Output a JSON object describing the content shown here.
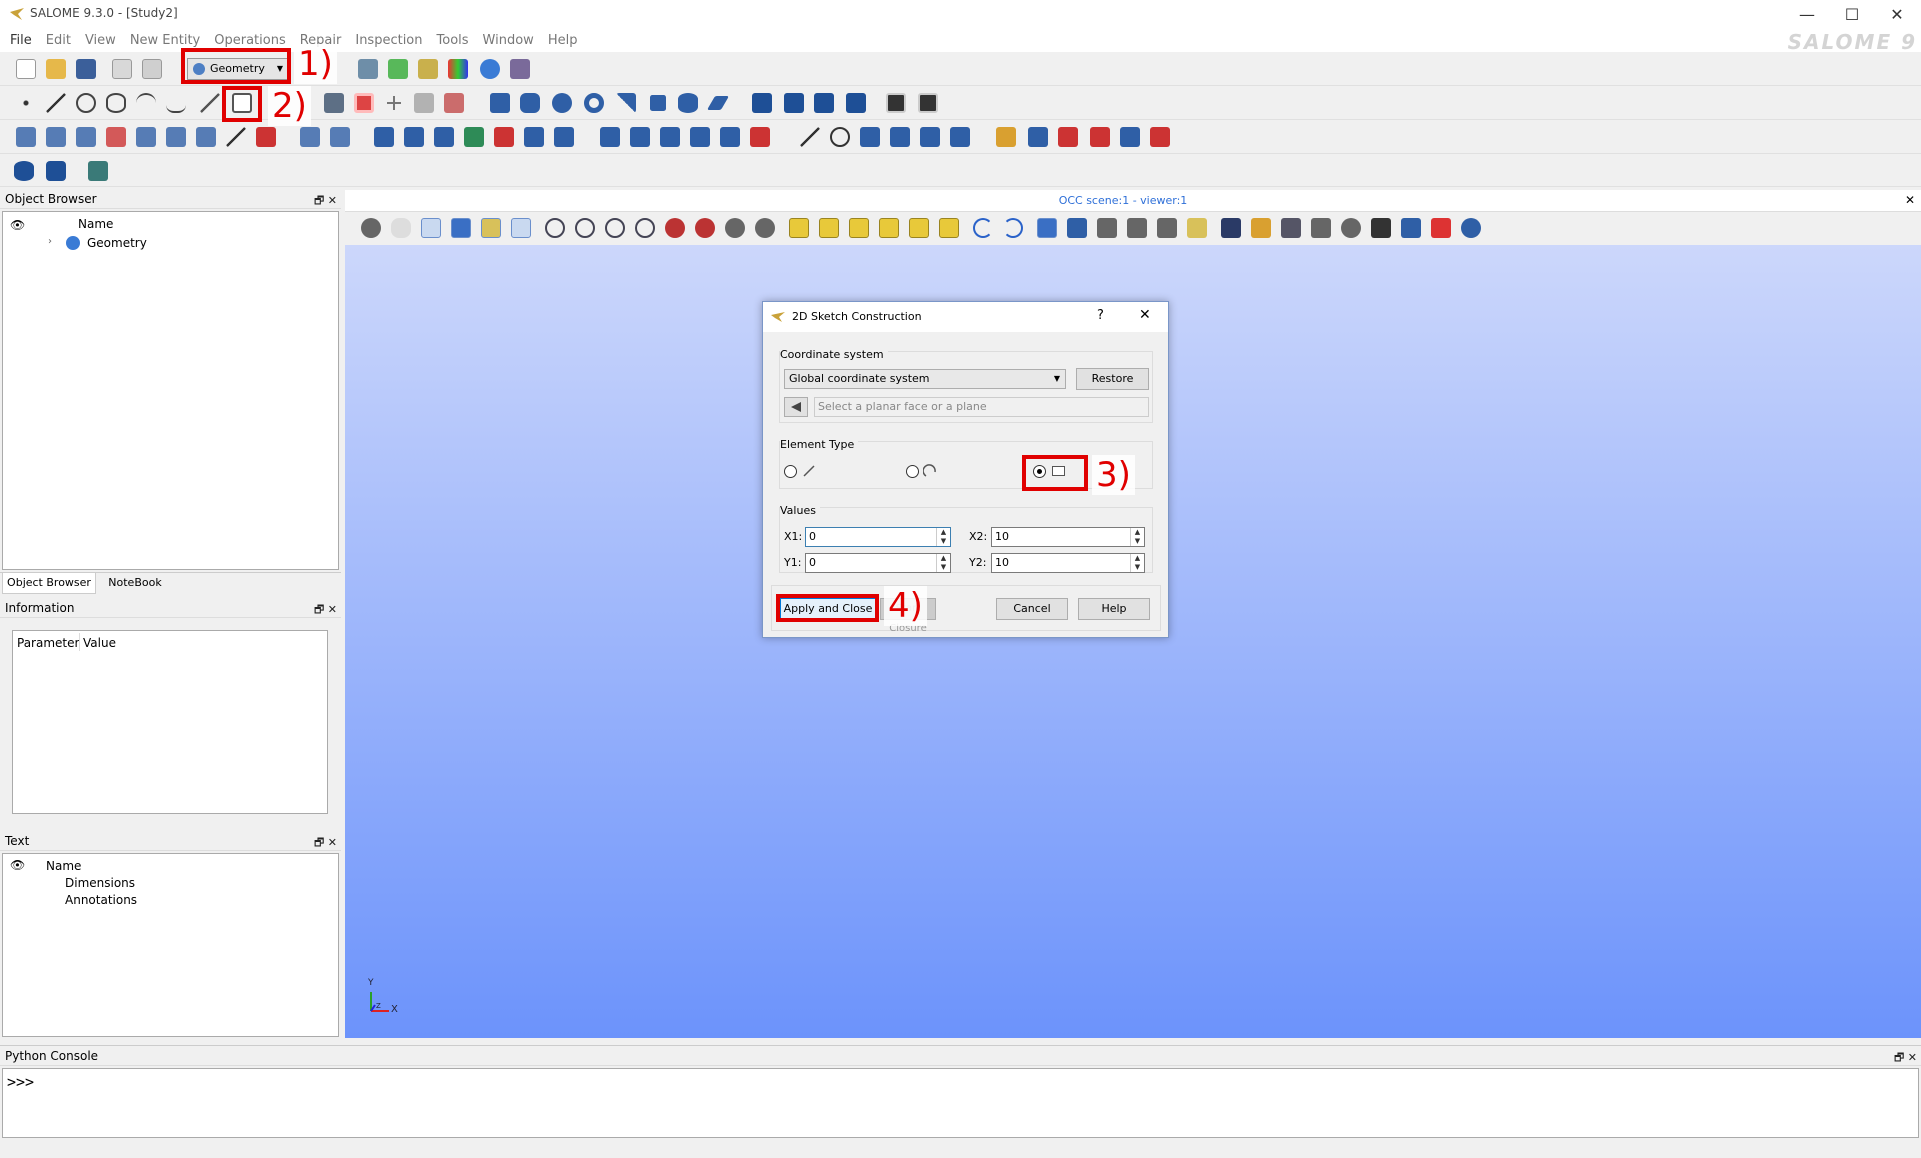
{
  "window": {
    "title": "SALOME 9.3.0 - [Study2]",
    "brand": "SALOME 9",
    "minimize": "—",
    "maximize": "☐",
    "close": "✕"
  },
  "menu": [
    "File",
    "Edit",
    "View",
    "New Entity",
    "Operations",
    "Repair",
    "Inspection",
    "Tools",
    "Window",
    "Help"
  ],
  "toolbar": {
    "module_selector": "Geometry"
  },
  "object_browser": {
    "title": "Object Browser",
    "column_name": "Name",
    "root_item": "Geometry",
    "tabs": [
      "Object Browser",
      "NoteBook"
    ]
  },
  "information": {
    "title": "Information",
    "columns": [
      "Parameter",
      "Value"
    ]
  },
  "text_panel": {
    "title": "Text",
    "column_name": "Name",
    "items": [
      "Dimensions",
      "Annotations"
    ]
  },
  "viewer": {
    "title": "OCC scene:1 - viewer:1",
    "axis_x": "X",
    "axis_y": "Y",
    "axis_z": "Z"
  },
  "dialog": {
    "title": "2D Sketch Construction",
    "help_glyph": "?",
    "close_glyph": "✕",
    "coord_group": "Coordinate system",
    "coord_value": "Global coordinate system",
    "restore_label": "Restore",
    "plane_placeholder": "Select a planar face or a plane",
    "element_group": "Element Type",
    "values_group": "Values",
    "x1_label": "X1:",
    "x1_value": "0",
    "x2_label": "X2:",
    "x2_value": "10",
    "y1_label": "Y1:",
    "y1_value": "0",
    "y2_label": "Y2:",
    "y2_value": "10",
    "apply_close_label": "Apply and Close",
    "apply_hidden_label": "Start Closure",
    "cancel_label": "Cancel",
    "help_label": "Help"
  },
  "annotations": [
    "1)",
    "2)",
    "3)",
    "4)"
  ],
  "python_console": {
    "title": "Python Console",
    "prompt": ">>>"
  },
  "colors": {
    "accent_red": "#e00000",
    "viewer_top": "#ccd7fb",
    "viewer_bottom": "#6c93fb",
    "viewer_title": "#2e6fd8"
  }
}
